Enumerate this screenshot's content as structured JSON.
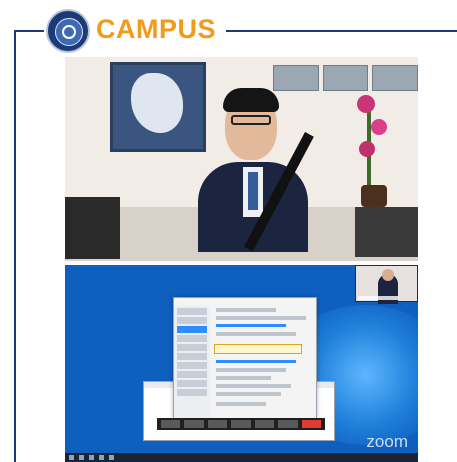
{
  "brand": {
    "name": "CAMPUS",
    "color": "#f19a1c",
    "line_color": "#1d3a78"
  },
  "logo": {
    "icon": "institution-seal-icon"
  },
  "video_main": {
    "description_icon": "presenter-video-icon"
  },
  "screen_share": {
    "watermark": "zoom",
    "thumbnail_icon": "participant-thumbnail-icon"
  }
}
